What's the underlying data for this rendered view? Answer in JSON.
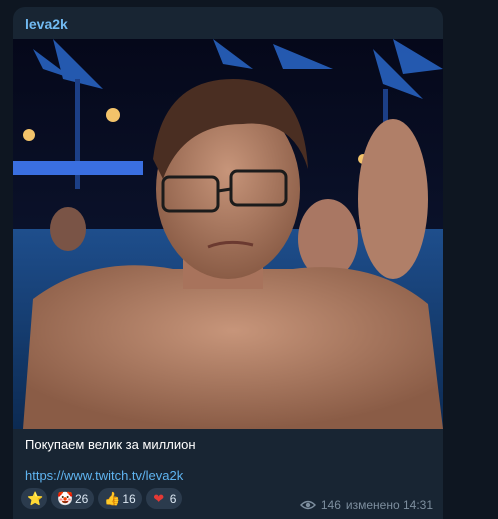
{
  "post": {
    "channel": "leva2k",
    "caption": "Покупаем велик за миллион",
    "link": "https://www.twitch.tv/leva2k",
    "views": "146",
    "edited_time": "изменено 14:31"
  },
  "reactions": [
    {
      "icon": "star-icon",
      "glyph": "⭐",
      "count": ""
    },
    {
      "icon": "clown-face-icon",
      "glyph": "🤡",
      "count": "26"
    },
    {
      "icon": "thumbs-up-icon",
      "glyph": "👍",
      "count": "16"
    },
    {
      "icon": "heart-icon",
      "glyph": "❤",
      "count": "6"
    }
  ],
  "colors": {
    "background": "#0e1621",
    "bubble": "#182533",
    "accent": "#71baf2",
    "link": "#5fb4f0"
  }
}
